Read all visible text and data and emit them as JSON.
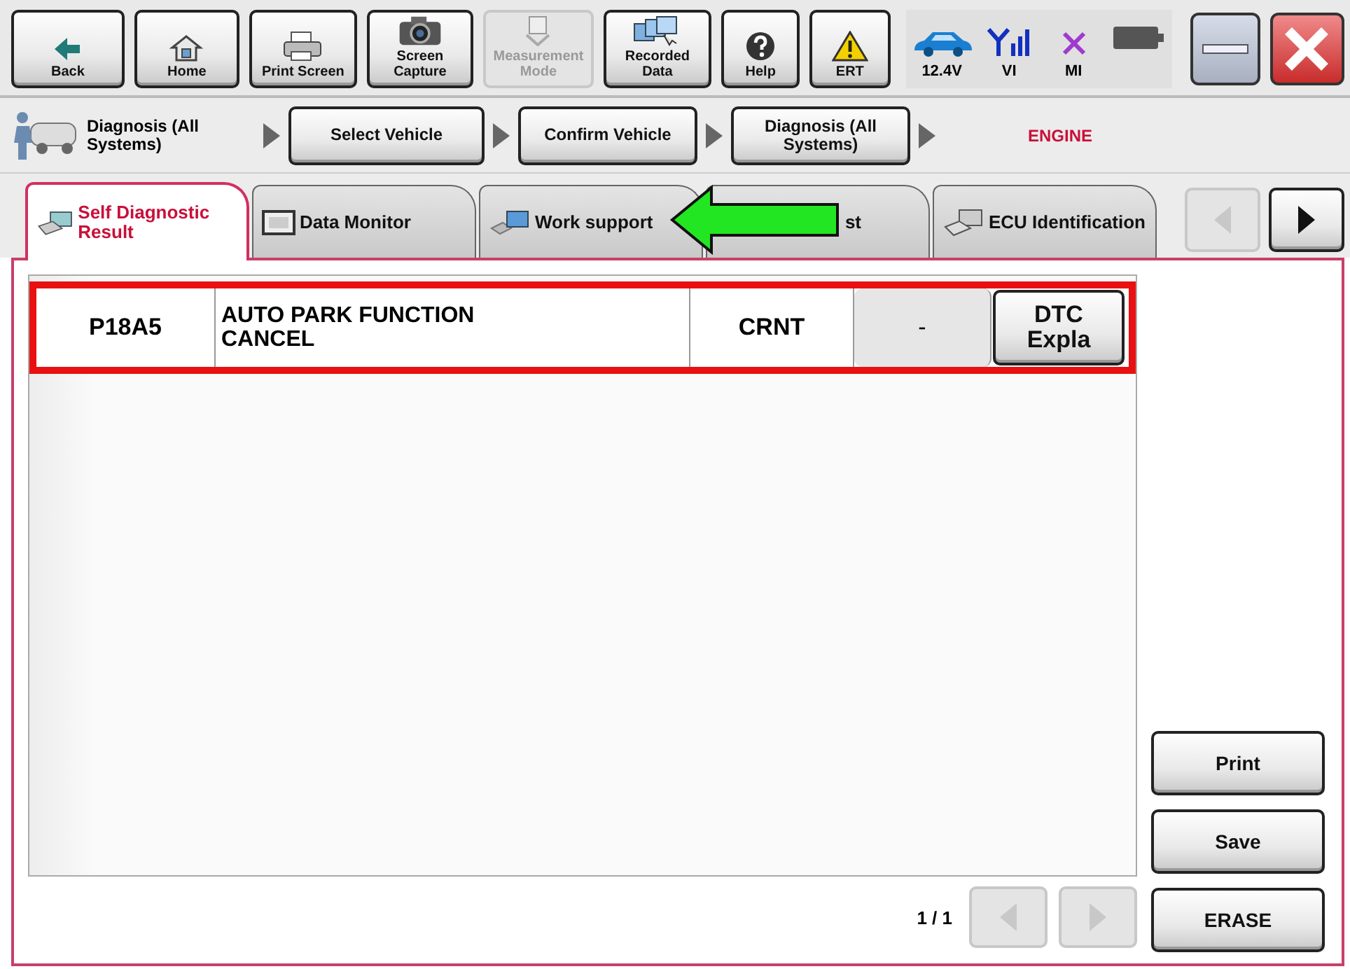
{
  "toolbar": {
    "buttons": [
      {
        "kind": "back",
        "label": "Back",
        "disabled": false
      },
      {
        "kind": "home",
        "label": "Home",
        "disabled": false
      },
      {
        "kind": "print",
        "label": "Print Screen",
        "disabled": false
      },
      {
        "kind": "camera",
        "label": "Screen Capture",
        "disabled": false
      },
      {
        "kind": "measure",
        "label": "Measurement Mode",
        "disabled": true
      },
      {
        "kind": "recorded",
        "label": "Recorded Data",
        "disabled": false
      },
      {
        "kind": "help",
        "label": "Help",
        "disabled": false
      },
      {
        "kind": "ert",
        "label": "ERT",
        "disabled": false
      }
    ],
    "status": [
      {
        "kind": "car",
        "label": "12.4V"
      },
      {
        "kind": "signal",
        "label": "VI"
      },
      {
        "kind": "cross",
        "label": "MI"
      },
      {
        "kind": "battery"
      }
    ]
  },
  "breadcrumb": {
    "current": "Diagnosis (All Systems)",
    "steps": [
      "Select Vehicle",
      "Confirm Vehicle",
      "Diagnosis (All Systems)"
    ],
    "system": "ENGINE"
  },
  "tabs": [
    {
      "label": "Self Diagnostic Result",
      "selected": true
    },
    {
      "label": "Data Monitor",
      "selected": false
    },
    {
      "label": "Work support",
      "selected": false
    },
    {
      "label": "st",
      "selected": false
    },
    {
      "label": "ECU Identification",
      "selected": false
    }
  ],
  "tab_nav": {
    "prev_disabled": true,
    "next_disabled": false
  },
  "results": {
    "rows": [
      {
        "code": "P18A5",
        "description": "AUTO PARK FUNCTION CANCEL",
        "status": "CRNT",
        "column_4": "-",
        "button": "DTC Expla",
        "selected": true
      }
    ]
  },
  "pager": {
    "page": "1 / 1",
    "prev_disabled": true,
    "next_disabled": true
  },
  "actions": [
    "Print",
    "Save",
    "ERASE"
  ]
}
